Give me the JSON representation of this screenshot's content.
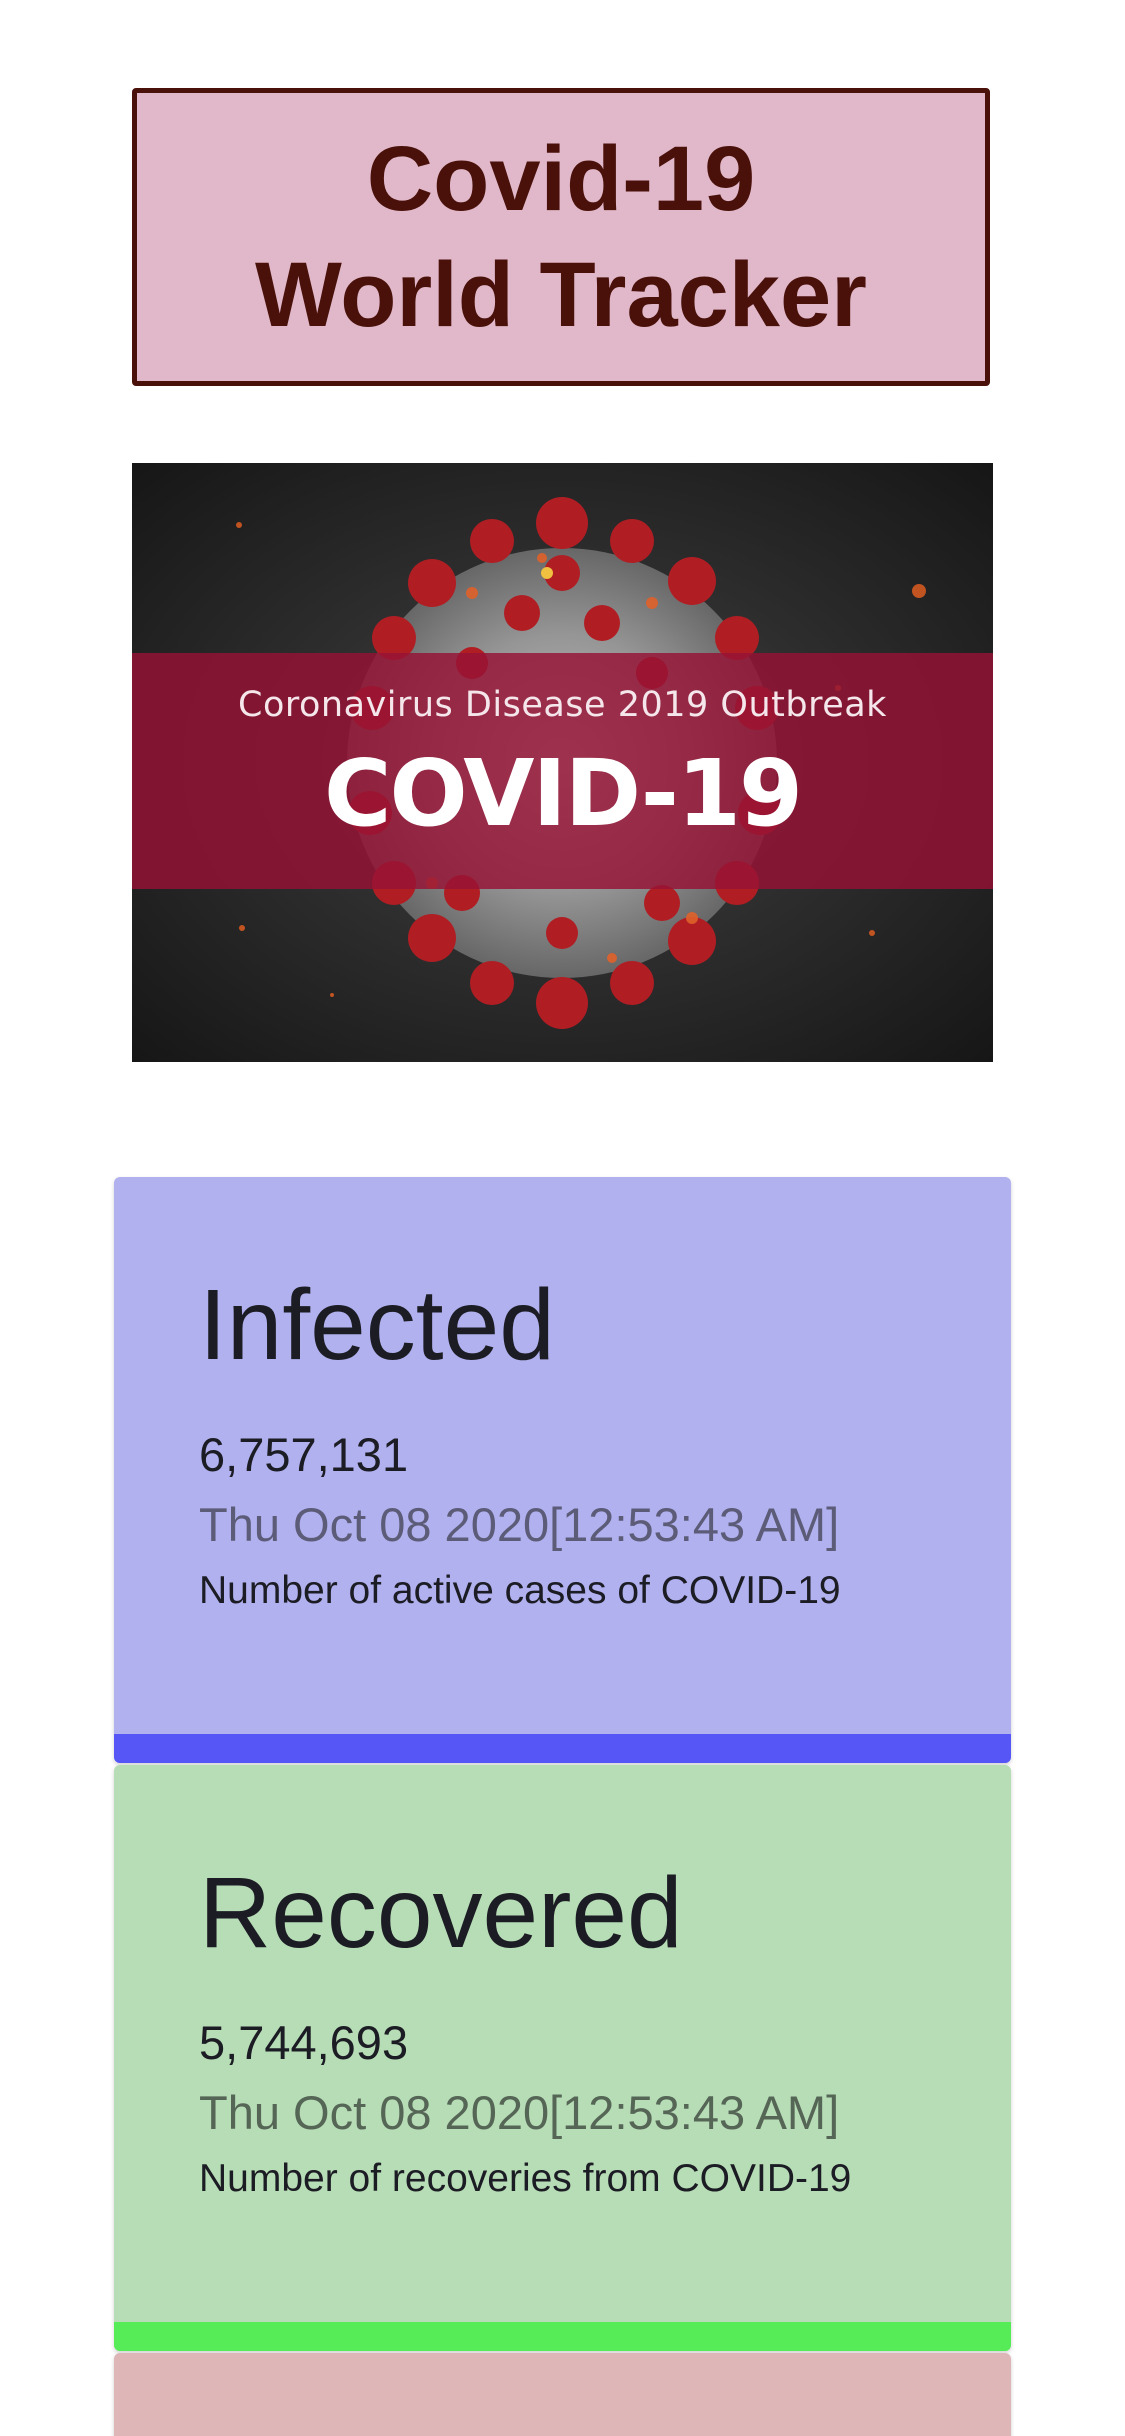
{
  "header": {
    "title_line1": "Covid-19",
    "title_line2": "World Tracker"
  },
  "banner": {
    "subtitle": "Coronavirus Disease 2019 Outbreak",
    "title": "COVID-19"
  },
  "cards": [
    {
      "heading": "Infected",
      "value": "6,757,131",
      "date": "Thu Oct 08 2020[12:53:43 AM]",
      "description": "Number of active cases of COVID-19",
      "background_color": "#b1b1ef",
      "accent_color": "#5656f6"
    },
    {
      "heading": "Recovered",
      "value": "5,744,693",
      "date": "Thu Oct 08 2020[12:53:43 AM]",
      "description": "Number of recoveries from COVID-19",
      "background_color": "#b7ddb6",
      "accent_color": "#55ec58"
    },
    {
      "background_color": "#dfb6b7"
    }
  ],
  "colors": {
    "title_text": "#4a100a",
    "title_background": "#e0b8c9"
  }
}
